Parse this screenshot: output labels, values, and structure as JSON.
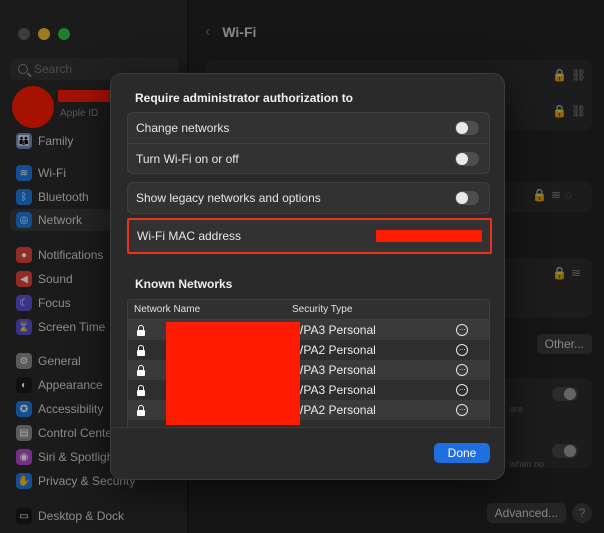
{
  "sidebar": {
    "search_placeholder": "Search",
    "apple_id_label": "Apple ID",
    "items": [
      {
        "label": "Family",
        "color": "#6a8fc8",
        "glyph": "👪"
      },
      {
        "label": "Wi-Fi",
        "color": "#1f7ae0",
        "glyph": "≋"
      },
      {
        "label": "Bluetooth",
        "color": "#1f7ae0",
        "glyph": "ᛒ"
      },
      {
        "label": "Network",
        "color": "#1f7ae0",
        "glyph": "◎"
      },
      {
        "label": "Notifications",
        "color": "#e0453a",
        "glyph": "●"
      },
      {
        "label": "Sound",
        "color": "#e0453a",
        "glyph": "◀"
      },
      {
        "label": "Focus",
        "color": "#5a4fd0",
        "glyph": "☾"
      },
      {
        "label": "Screen Time",
        "color": "#5a4fd0",
        "glyph": "⌛"
      },
      {
        "label": "General",
        "color": "#8a8a8a",
        "glyph": "⚙"
      },
      {
        "label": "Appearance",
        "color": "#1a1a1a",
        "glyph": "◐"
      },
      {
        "label": "Accessibility",
        "color": "#1f7ae0",
        "glyph": "✪"
      },
      {
        "label": "Control Cente",
        "color": "#8a8a8a",
        "glyph": "▤"
      },
      {
        "label": "Siri & Spotligh",
        "color": "#b04ad0",
        "glyph": "◉"
      },
      {
        "label": "Privacy & Security",
        "color": "#1f7ae0",
        "glyph": "✋"
      },
      {
        "label": "Desktop & Dock",
        "color": "#1a1a1a",
        "glyph": "▭"
      }
    ]
  },
  "main": {
    "title": "Wi-Fi",
    "back_glyph": "‹",
    "other_button": "Other...",
    "advanced_button": "Advanced...",
    "help_glyph": "?",
    "bg_text_1": "are",
    "bg_text_2": "when no"
  },
  "sheet": {
    "auth_heading": "Require administrator authorization to",
    "auth_rows": [
      {
        "label": "Change networks"
      },
      {
        "label": "Turn Wi-Fi on or off"
      }
    ],
    "legacy_label": "Show legacy networks and options",
    "mac_label": "Wi-Fi MAC address",
    "known_heading": "Known Networks",
    "columns": {
      "name": "Network Name",
      "security": "Security Type"
    },
    "networks": [
      {
        "security": "WPA3 Personal"
      },
      {
        "security": "WPA2 Personal"
      },
      {
        "security": "WPA3 Personal"
      },
      {
        "security": "WPA3 Personal"
      },
      {
        "security": "WPA2 Personal"
      }
    ],
    "more_glyph": "···",
    "done_label": "Done"
  },
  "colors": {
    "accent": "#1f6fe0",
    "highlight_border": "#e8321e",
    "redaction": "#ff1b00"
  }
}
